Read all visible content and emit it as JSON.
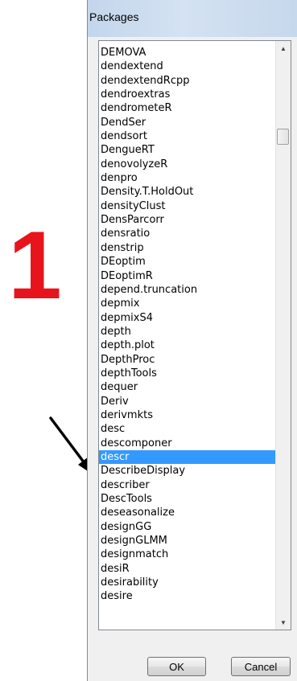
{
  "annotation": {
    "number": "1",
    "color": "#e8141c"
  },
  "dialog": {
    "title": "Packages",
    "packages": [
      "DEMOVA",
      "dendextend",
      "dendextendRcpp",
      "dendroextras",
      "dendrometeR",
      "DendSer",
      "dendsort",
      "DengueRT",
      "denovolyzeR",
      "denpro",
      "Density.T.HoldOut",
      "densityClust",
      "DensParcorr",
      "densratio",
      "denstrip",
      "DEoptim",
      "DEoptimR",
      "depend.truncation",
      "depmix",
      "depmixS4",
      "depth",
      "depth.plot",
      "DepthProc",
      "depthTools",
      "dequer",
      "Deriv",
      "derivmkts",
      "desc",
      "descomponer",
      "descr",
      "DescribeDisplay",
      "describer",
      "DescTools",
      "deseasonalize",
      "designGG",
      "designGLMM",
      "designmatch",
      "desiR",
      "desirability",
      "desire"
    ],
    "selected_package": "descr",
    "selection_color": "#3399ff",
    "ok_label": "OK",
    "cancel_label": "Cancel"
  }
}
